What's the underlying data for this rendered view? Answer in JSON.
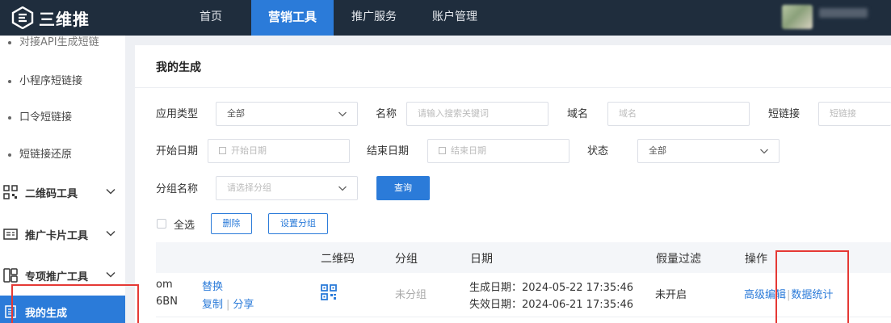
{
  "app": {
    "name": "三维推"
  },
  "nav": {
    "items": [
      {
        "label": "首页"
      },
      {
        "label": "营销工具"
      },
      {
        "label": "推广服务"
      },
      {
        "label": "账户管理"
      }
    ]
  },
  "sidebar": {
    "cut_item": "对接API生成短链",
    "sub_items": [
      {
        "label": "小程序短链接"
      },
      {
        "label": "口令短链接"
      },
      {
        "label": "短链接还原"
      }
    ],
    "groups": [
      {
        "label": "二维码工具"
      },
      {
        "label": "推广卡片工具"
      },
      {
        "label": "专项推广工具"
      }
    ],
    "active": "我的生成"
  },
  "main": {
    "title": "我的生成",
    "filters": {
      "app_type_label": "应用类型",
      "app_type_value": "全部",
      "name_label": "名称",
      "name_placeholder": "请输入搜索关键词",
      "domain_label": "域名",
      "domain_placeholder": "域名",
      "short_label": "短链接",
      "short_placeholder": "短链接",
      "start_label": "开始日期",
      "start_placeholder": "开始日期",
      "end_label": "结束日期",
      "end_placeholder": "结束日期",
      "status_label": "状态",
      "status_value": "全部",
      "group_label": "分组名称",
      "group_placeholder": "请选择分组",
      "query_button": "查询"
    },
    "actions": {
      "select_all": "全选",
      "delete": "删除",
      "set_group": "设置分组"
    },
    "table": {
      "headers": {
        "qrcode": "二维码",
        "group": "分组",
        "date": "日期",
        "fake_filter": "假量过滤",
        "ops": "操作"
      },
      "rows": [
        {
          "url_frag_1": "om",
          "url_frag_2": "6BN",
          "replace": "替换",
          "copy": "复制",
          "share": "分享",
          "group": "未分组",
          "created": "生成日期：2024-05-22 17:35:46",
          "expires": "失效日期：2024-06-21 17:35:46",
          "fake_filter": "未开启",
          "advanced_edit": "高级编辑",
          "stats": "数据统计"
        }
      ]
    }
  }
}
